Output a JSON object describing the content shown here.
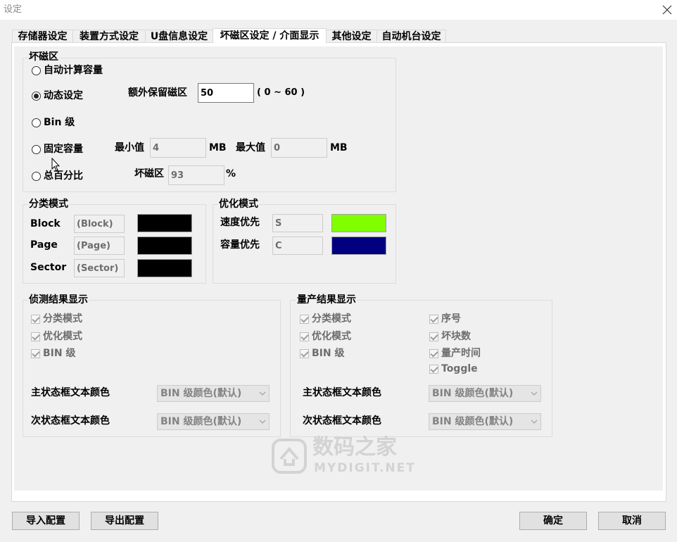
{
  "window": {
    "title": "设定"
  },
  "tabs": [
    {
      "label": "存储器设定",
      "active": false
    },
    {
      "label": "装置方式设定",
      "active": false
    },
    {
      "label": "U盘信息设定",
      "active": false
    },
    {
      "label": "坏磁区设定 / 介面显示",
      "active": true
    },
    {
      "label": "其他设定",
      "active": false
    },
    {
      "label": "自动机台设定",
      "active": false
    }
  ],
  "bad_block": {
    "title": "坏磁区",
    "options": [
      {
        "label": "自动计算容量",
        "checked": false
      },
      {
        "label": "动态设定",
        "checked": true
      },
      {
        "label": "Bin 级",
        "checked": false
      },
      {
        "label": "固定容量",
        "checked": false
      },
      {
        "label": "总百分比",
        "checked": false
      }
    ],
    "extra_reserved": {
      "label": "额外保留磁区",
      "value": "50",
      "range": "( 0 ~ 60 )"
    },
    "fixed": {
      "min_label": "最小值",
      "min_value": "4",
      "max_label": "最大值",
      "max_value": "0",
      "unit": "MB"
    },
    "percent": {
      "label": "坏磁区",
      "value": "93",
      "unit": "%"
    }
  },
  "classify": {
    "title": "分类模式",
    "rows": [
      {
        "label": "Block",
        "value": "(Block)",
        "color": "#000000"
      },
      {
        "label": "Page",
        "value": "(Page)",
        "color": "#000000"
      },
      {
        "label": "Sector",
        "value": "(Sector)",
        "color": "#000000"
      }
    ]
  },
  "optimize": {
    "title": "优化模式",
    "rows": [
      {
        "label": "速度优先",
        "value": "S",
        "color": "#80ff00"
      },
      {
        "label": "容量优先",
        "value": "C",
        "color": "#000080"
      }
    ]
  },
  "detect": {
    "title": "侦测结果显示",
    "checkboxes": [
      {
        "label": "分类模式",
        "checked": true
      },
      {
        "label": "优化模式",
        "checked": true
      },
      {
        "label": "BIN 级",
        "checked": true
      }
    ],
    "main_color": {
      "label": "主状态框文本颜色",
      "value": "BIN 级颜色(默认)"
    },
    "sub_color": {
      "label": "次状态框文本颜色",
      "value": "BIN 级颜色(默认)"
    }
  },
  "production": {
    "title": "量产结果显示",
    "checkboxes_left": [
      {
        "label": "分类模式",
        "checked": true
      },
      {
        "label": "优化模式",
        "checked": true
      },
      {
        "label": "BIN 级",
        "checked": true
      }
    ],
    "checkboxes_right": [
      {
        "label": "序号",
        "checked": true
      },
      {
        "label": "坏块数",
        "checked": true
      },
      {
        "label": "量产时间",
        "checked": true
      },
      {
        "label": "Toggle",
        "checked": true
      }
    ],
    "main_color": {
      "label": "主状态框文本颜色",
      "value": "BIN 级颜色(默认)"
    },
    "sub_color": {
      "label": "次状态框文本颜色",
      "value": "BIN 级颜色(默认)"
    }
  },
  "buttons": {
    "import": "导入配置",
    "export": "导出配置",
    "ok": "确定",
    "cancel": "取消"
  },
  "watermark": {
    "text": "数码之家",
    "subtext": "MYDIGIT.NET"
  },
  "icons": {
    "close": "close-icon",
    "dropdown": "chevron-down-icon",
    "cursor": "mouse-cursor-icon",
    "watermark_logo": "watermark-logo-icon"
  }
}
